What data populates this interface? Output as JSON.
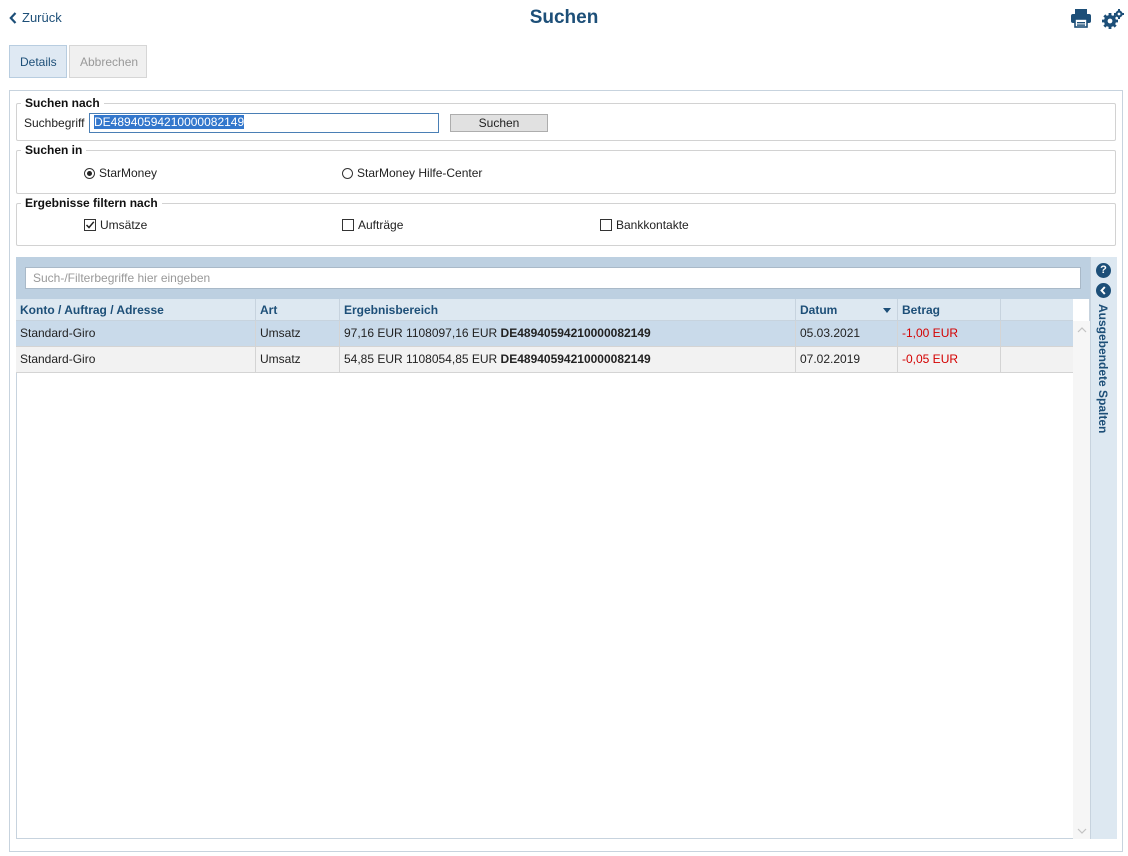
{
  "header": {
    "back_label": "Zurück",
    "title": "Suchen",
    "print_icon": "printer-icon",
    "settings_icon": "gears-icon"
  },
  "tabs": [
    {
      "label": "Details",
      "active": true
    },
    {
      "label": "Abbrechen",
      "active": false
    }
  ],
  "search_by": {
    "legend": "Suchen nach",
    "field_label": "Suchbegriff",
    "value": "DE48940594210000082149",
    "button_label": "Suchen"
  },
  "search_in": {
    "legend": "Suchen in",
    "options": [
      {
        "label": "StarMoney",
        "selected": true
      },
      {
        "label": "StarMoney Hilfe-Center",
        "selected": false
      }
    ]
  },
  "filter": {
    "legend": "Ergebnisse filtern nach",
    "options": [
      {
        "label": "Umsätze",
        "checked": true
      },
      {
        "label": "Aufträge",
        "checked": false
      },
      {
        "label": "Bankkontakte",
        "checked": false
      }
    ]
  },
  "results": {
    "filter_placeholder": "Such-/Filterbegriffe hier eingeben",
    "columns": [
      "Konto / Auftrag / Adresse",
      "Art",
      "Ergebnisbereich",
      "Datum",
      "Betrag"
    ],
    "sort_column": "Datum",
    "rows": [
      {
        "konto": "Standard-Giro",
        "art": "Umsatz",
        "bereich_prefix": "97,16 EUR 1108097,16 EUR ",
        "bereich_match": "DE48940594210000082149",
        "datum": "05.03.2021",
        "betrag": "-1,00 EUR"
      },
      {
        "konto": "Standard-Giro",
        "art": "Umsatz",
        "bereich_prefix": "54,85 EUR 1108054,85 EUR ",
        "bereich_match": "DE48940594210000082149",
        "datum": "07.02.2019",
        "betrag": "-0,05 EUR"
      }
    ],
    "side_panel_label": "Ausgebendete Spalten"
  },
  "colors": {
    "accent": "#1d4f78",
    "selected_row": "#c9daea",
    "negative": "#d40000"
  }
}
